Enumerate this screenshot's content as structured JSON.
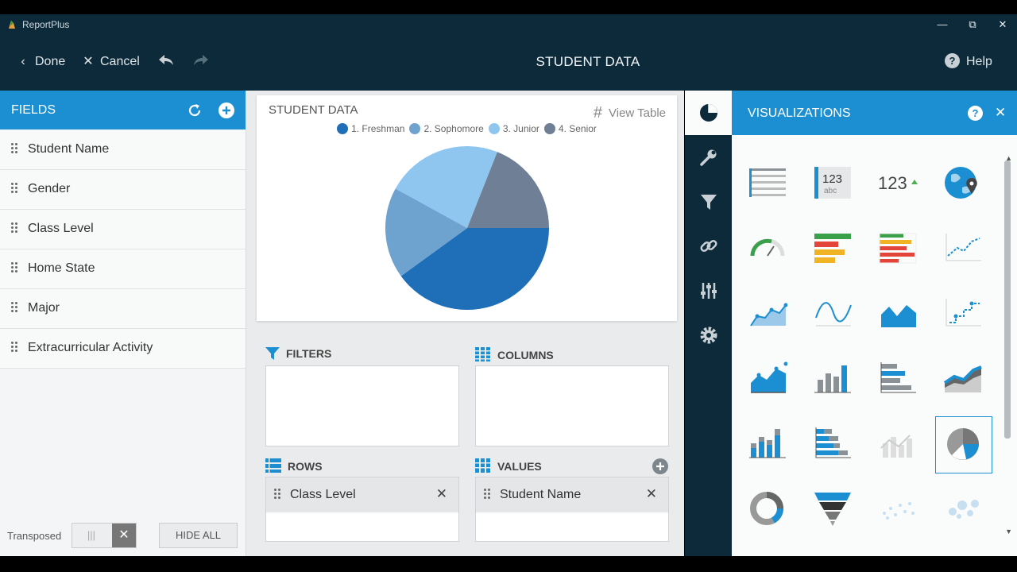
{
  "window": {
    "app_name": "ReportPlus",
    "minimize": "—",
    "restore": "⧉",
    "close": "✕"
  },
  "header": {
    "done_label": "Done",
    "cancel_label": "Cancel",
    "title": "STUDENT DATA",
    "help_label": "Help"
  },
  "fields": {
    "title": "FIELDS",
    "items": [
      {
        "label": "Student Name"
      },
      {
        "label": "Gender"
      },
      {
        "label": "Class Level"
      },
      {
        "label": "Home State"
      },
      {
        "label": "Major"
      },
      {
        "label": "Extracurricular Activity"
      }
    ],
    "transposed_label": "Transposed",
    "hide_all_label": "HIDE ALL"
  },
  "chart_data": {
    "type": "pie",
    "title": "STUDENT DATA",
    "view_table_label": "View Table",
    "legend_position": "top",
    "categories": [
      "1. Freshman",
      "2. Sophomore",
      "3. Junior",
      "4. Senior"
    ],
    "values": [
      40,
      18,
      23,
      19
    ],
    "colors": [
      "#1f6fb8",
      "#6fa3cf",
      "#8ec6f0",
      "#6e7f96"
    ]
  },
  "sections": {
    "filters": {
      "label": "FILTERS"
    },
    "columns": {
      "label": "COLUMNS"
    },
    "rows": {
      "label": "ROWS",
      "chip": "Class Level"
    },
    "values": {
      "label": "VALUES",
      "chip": "Student Name"
    }
  },
  "sidetabs": [
    "pie-chart-icon",
    "wrench-icon",
    "filter-icon",
    "link-icon",
    "sliders-icon",
    "gear-icon"
  ],
  "visualizations": {
    "title": "VISUALIZATIONS",
    "selected": "pie-chart-icon",
    "icons": [
      "grid-table-icon",
      "text-view-icon",
      "kpi-icon",
      "map-icon",
      "gauge-icon",
      "bullet-graph-icon",
      "colored-bars-icon",
      "line-chart-icon",
      "area-points-icon",
      "spline-icon",
      "area-chart-icon",
      "step-line-icon",
      "stacked-area-icon",
      "column-chart-icon",
      "bar-chart-icon",
      "stacked-band-icon",
      "stacked-column-icon",
      "stacked-bar-icon",
      "combo-chart-icon",
      "pie-chart-icon",
      "doughnut-icon",
      "funnel-icon",
      "scatter-icon",
      "bubble-icon"
    ],
    "kpi_text": "123",
    "text_view_text": "123",
    "text_view_sub": "abc"
  },
  "colors": {
    "header_bg": "#0d2a3a",
    "accent": "#1b8fd1"
  }
}
